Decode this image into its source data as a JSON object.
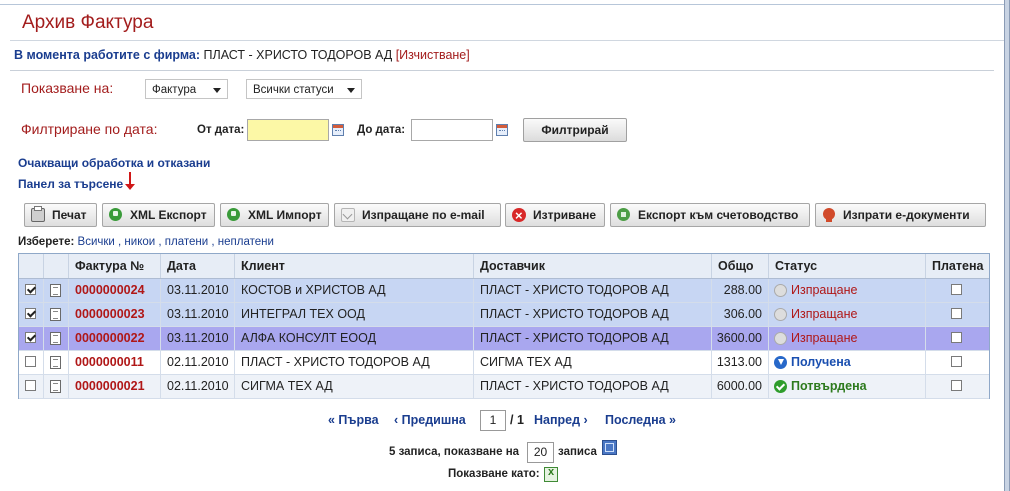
{
  "page": {
    "title": "Архив Фактура",
    "firm_label": "В момента работите с фирма:",
    "firm_name": "ПЛАСТ - ХРИСТО ТОДОРОВ АД",
    "clear_label": "[Изчистване]"
  },
  "filters": {
    "show_label": "Показване на:",
    "doc_type": "Фактура",
    "status": "Всички статуси",
    "date_filter_label": "Филтриране по дата:",
    "from_label": "От дата:",
    "to_label": "До дата:",
    "filter_button": "Филтрирай",
    "date_from_color": "#fcf8a6"
  },
  "links": {
    "pending": "Очакващи обработка и отказани",
    "search_panel": "Панел за търсене"
  },
  "toolbar": {
    "print": "Печат",
    "xml_export": "XML Експорт",
    "xml_import": "XML Импорт",
    "send_email": "Изпращане по e-mail",
    "delete": "Изтриване",
    "export_accounting": "Експорт към счетоводство",
    "send_edocs": "Изпрати е-документи"
  },
  "selection": {
    "label": "Изберете:",
    "all": "Всички",
    "none": "никои",
    "paid": "платени",
    "unpaid": "неплатени"
  },
  "table": {
    "headers": {
      "invoice_no": "Фактура №",
      "date": "Дата",
      "client": "Клиент",
      "supplier": "Доставчик",
      "total": "Общо",
      "status": "Статус",
      "paid": "Платена"
    },
    "rows": [
      {
        "checked": true,
        "invoice_no": "0000000024",
        "date": "03.11.2010",
        "client": "КОСТОВ и ХРИСТОВ АД",
        "supplier": "ПЛАСТ - ХРИСТО ТОДОРОВ АД",
        "total": "288.00",
        "status": "Изпращане",
        "status_kind": "sending",
        "paid": false
      },
      {
        "checked": true,
        "invoice_no": "0000000023",
        "date": "03.11.2010",
        "client": "ИНТЕГРАЛ ТЕХ ООД",
        "supplier": "ПЛАСТ - ХРИСТО ТОДОРОВ АД",
        "total": "306.00",
        "status": "Изпращане",
        "status_kind": "sending",
        "paid": false
      },
      {
        "checked": true,
        "invoice_no": "0000000022",
        "date": "03.11.2010",
        "client": "АЛФА КОНСУЛТ ЕООД",
        "supplier": "ПЛАСТ - ХРИСТО ТОДОРОВ АД",
        "total": "3600.00",
        "status": "Изпращане",
        "status_kind": "sending",
        "paid": false
      },
      {
        "checked": false,
        "invoice_no": "0000000011",
        "date": "02.11.2010",
        "client": "ПЛАСТ - ХРИСТО ТОДОРОВ АД",
        "supplier": "СИГМА ТЕХ АД",
        "total": "1313.00",
        "status": "Получена",
        "status_kind": "received",
        "paid": false
      },
      {
        "checked": false,
        "invoice_no": "0000000021",
        "date": "02.11.2010",
        "client": "СИГМА ТЕХ АД",
        "supplier": "ПЛАСТ - ХРИСТО ТОДОРОВ АД",
        "total": "6000.00",
        "status": "Потвърдена",
        "status_kind": "confirmed",
        "paid": false
      }
    ]
  },
  "pager": {
    "first": "« Първа",
    "prev": "‹ Предишна",
    "page": "1",
    "total": "/ 1",
    "next": "Напред ›",
    "last": "Последна »",
    "records_text": "5 записа, показване на",
    "per_page": "20",
    "records_suffix": "записа",
    "show_as": "Показване като:"
  }
}
